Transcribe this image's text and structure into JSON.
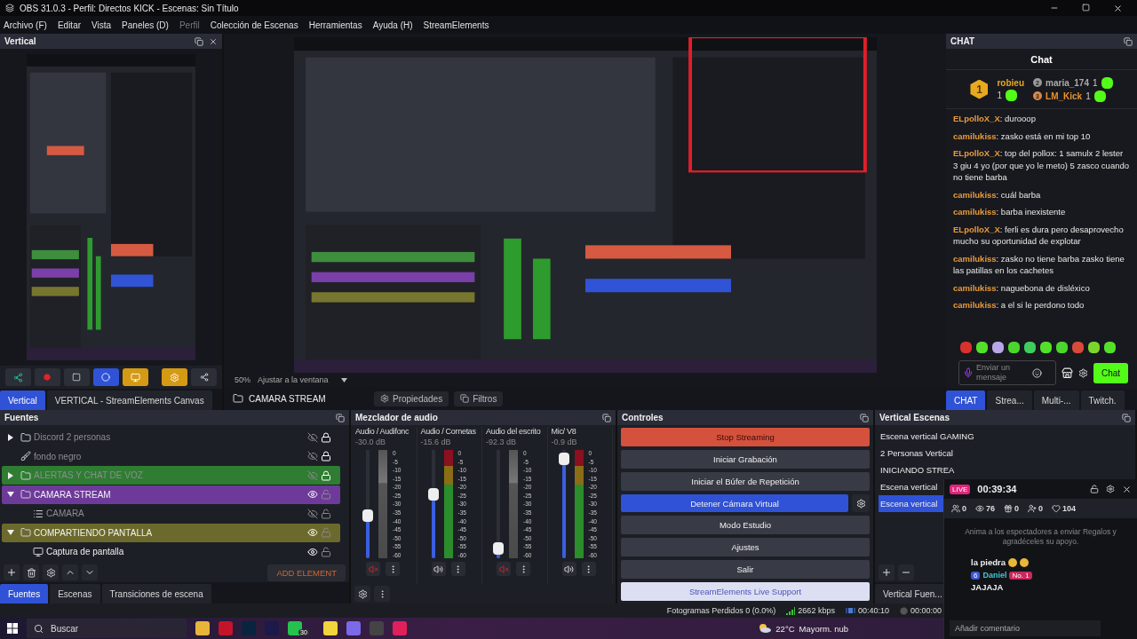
{
  "window": {
    "title": "OBS 31.0.3 - Perfil: Directos KICK - Escenas: Sin Título"
  },
  "menu": [
    {
      "label": "Archivo (F)",
      "disabled": false
    },
    {
      "label": "Editar",
      "disabled": false
    },
    {
      "label": "Vista",
      "disabled": false
    },
    {
      "label": "Paneles (D)",
      "disabled": false
    },
    {
      "label": "Perfil",
      "disabled": true
    },
    {
      "label": "Colección de Escenas",
      "disabled": false
    },
    {
      "label": "Herramientas",
      "disabled": false
    },
    {
      "label": "Ayuda (H)",
      "disabled": false
    },
    {
      "label": "StreamElements",
      "disabled": false
    }
  ],
  "vertical_dock": {
    "title": "Vertical",
    "tabs": [
      {
        "label": "Vertical",
        "selected": true
      },
      {
        "label": "VERTICAL - StreamElements Canvas",
        "selected": false
      }
    ]
  },
  "preview": {
    "zoom": "50%",
    "fit": "Ajustar a la ventana"
  },
  "source_toolbar": {
    "source": "CAMARA STREAM",
    "properties": "Propiedades",
    "filters": "Filtros"
  },
  "chat_dock": {
    "title": "CHAT",
    "heading": "Chat",
    "leaders": [
      {
        "rank": "1",
        "name": "robieu",
        "count": "1"
      },
      {
        "rank": "2",
        "name": "maria_174",
        "count": "1"
      },
      {
        "rank": "3",
        "name": "LM_Kick",
        "count": "1"
      }
    ],
    "messages": [
      "**ELpolloX_X**: durooop",
      "**camilukiss**: zasko está en mi top 10",
      "**ELpolloX_X**: top del pollox: 1 samulx 2 lester 3 giu 4 yo (por que yo le meto) 5 zasco cuando no tiene barba",
      "**camilukiss**: cuál barba",
      "**camilukiss**: barba inexistente",
      "**ELpolloX_X**: ferli es dura pero desaprovecho mucho su oportunidad de explotar",
      "**camilukiss**: zasko no tiene barba zasko tiene las patillas en los cachetes",
      "**camilukiss**: naguebona de disléxico",
      "**camilukiss**: a el si le perdono todo"
    ],
    "input": {
      "placeholder": "Enviar un mensaje"
    },
    "send": "Chat",
    "tabs": [
      {
        "label": "CHAT",
        "selected": true
      },
      {
        "label": "Strea...",
        "selected": false
      },
      {
        "label": "Multi-...",
        "selected": false
      },
      {
        "label": "Twitch.",
        "selected": false
      }
    ]
  },
  "sources": {
    "title": "Fuentes",
    "items": [
      {
        "name": "Discord 2 personas",
        "kind": "group",
        "expanded": false,
        "visible": false,
        "locked": true
      },
      {
        "name": "fondo negro",
        "kind": "brush",
        "visible": false,
        "locked": true
      },
      {
        "name": "ALERTAS Y CHAT DE VOZ",
        "kind": "group",
        "expanded": false,
        "visible": false,
        "locked": true,
        "color": "#2f7d32"
      },
      {
        "name": "CAMARA STREAM",
        "kind": "group",
        "expanded": true,
        "visible": true,
        "locked": false,
        "color": "#6e3a9a",
        "children": [
          {
            "name": "CAMARA",
            "kind": "list",
            "visible": false,
            "locked": false
          }
        ]
      },
      {
        "name": "COMPARTIENDO PANTALLA",
        "kind": "group",
        "expanded": true,
        "visible": true,
        "locked": false,
        "color": "#6b6a2c",
        "children": [
          {
            "name": "Captura de pantalla",
            "kind": "display",
            "visible": true,
            "locked": false
          }
        ]
      }
    ],
    "add_button": "ADD ELEMENT",
    "tabs": [
      {
        "label": "Fuentes",
        "selected": true
      },
      {
        "label": "Escenas",
        "selected": false
      },
      {
        "label": "Transiciones de escena",
        "selected": false
      }
    ]
  },
  "mixer": {
    "title": "Mezclador de audio",
    "channels": [
      {
        "name": "Audio / Audifonc",
        "reading": "-30.0 dB",
        "level": 0.38,
        "muted": true,
        "scale": [
          "0",
          "-5",
          "-10",
          "-15",
          "-20",
          "-25",
          "-30",
          "-35",
          "-40",
          "-45",
          "-50",
          "-55",
          "-60"
        ]
      },
      {
        "name": "Audio / Cornetas",
        "reading": "-15.6 dB",
        "level": 0.6,
        "muted": false,
        "scale": [
          "0",
          "-5",
          "-10",
          "-15",
          "-20",
          "-25",
          "-30",
          "-35",
          "-40",
          "-45",
          "-50",
          "-55",
          "-60"
        ]
      },
      {
        "name": "Audio del escrito",
        "reading": "-92.3 dB",
        "level": 0.04,
        "muted": true,
        "scale": [
          "0",
          "-5",
          "-10",
          "-15",
          "-20",
          "-25",
          "-30",
          "-35",
          "-40",
          "-45",
          "-50",
          "-55",
          "-60"
        ]
      },
      {
        "name": "Mic/ V8",
        "reading": "-0.9 dB",
        "level": 0.97,
        "muted": false,
        "scale": [
          "0",
          "-5",
          "-10",
          "-15",
          "-20",
          "-25",
          "-30",
          "-35",
          "-40",
          "-45",
          "-50",
          "-55",
          "-60"
        ]
      }
    ]
  },
  "controls": {
    "title": "Controles",
    "buttons": [
      {
        "label": "Stop Streaming",
        "kind": "stop"
      },
      {
        "label": "Iniciar Grabación",
        "kind": "normal"
      },
      {
        "label": "Iniciar el Búfer de Repetición",
        "kind": "normal"
      },
      {
        "label": "Detener Cámara Virtual",
        "kind": "virtualcam"
      },
      {
        "label": "Modo Estudio",
        "kind": "normal"
      },
      {
        "label": "Ajustes",
        "kind": "normal"
      },
      {
        "label": "Salir",
        "kind": "normal"
      },
      {
        "label": "StreamElements Live Support",
        "kind": "support"
      }
    ]
  },
  "scenes": {
    "title": "Vertical Escenas",
    "items": [
      {
        "label": "Escena vertical GAMING",
        "selected": false
      },
      {
        "label": "2 Personas Vertical",
        "selected": false
      },
      {
        "label": "INICIANDO STREA",
        "selected": false
      },
      {
        "label": "Escena vertical",
        "selected": false
      },
      {
        "label": "Escena vertical",
        "selected": true
      }
    ],
    "tabs": [
      {
        "label": "Vertical Fuen...",
        "selected": false
      }
    ]
  },
  "status_bar": [
    {
      "kind": "dropped",
      "text": "Fotogramas Perdidos 0 (0.0%)"
    },
    {
      "kind": "bitrate",
      "text": "2662 kbps"
    },
    {
      "kind": "stream",
      "text": "00:40:10"
    },
    {
      "kind": "record",
      "text": "00:00:00"
    }
  ],
  "live_overlay": {
    "badge": "LIVE",
    "time": "00:39:34",
    "stats": [
      {
        "kind": "users",
        "value": "0"
      },
      {
        "kind": "viewers",
        "value": "76"
      },
      {
        "kind": "gifts",
        "value": "0"
      },
      {
        "kind": "follows",
        "value": "0"
      },
      {
        "kind": "likes",
        "value": "104"
      }
    ],
    "prompt": "Anima a los espectadores a enviar Regalos y agradéceles su apoyo.",
    "comments": [
      {
        "kind": "plain",
        "text": "la piedra"
      },
      {
        "kind": "ranked",
        "level": "6",
        "user": "Daniel",
        "rank": "No. 1",
        "text": "JAJAJA"
      }
    ],
    "input": {
      "placeholder": "Añadir comentario"
    }
  },
  "taskbar": {
    "search": {
      "placeholder": "Buscar"
    },
    "badge": "30",
    "temperature": "22°C",
    "weather": "Mayorm. nub"
  }
}
